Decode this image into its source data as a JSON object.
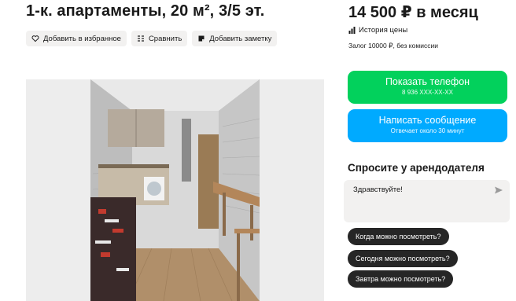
{
  "listing": {
    "title": "1-к. апартаменты, 20 м², 3/5 эт."
  },
  "actions": {
    "favorite": "Добавить в избранное",
    "compare": "Сравнить",
    "note": "Добавить заметку"
  },
  "pricing": {
    "price": "14 500 ₽ в месяц",
    "history": "История цены",
    "deposit": "Залог 10000 ₽, без комиссии"
  },
  "contact": {
    "phone_label": "Показать телефон",
    "phone_number": "8 936 XXX-XX-XX",
    "message_label": "Написать сообщение",
    "message_sub": "Отвечает около 30 минут"
  },
  "ask": {
    "title": "Спросите у арендодателя",
    "input_value": "Здравствуйте!",
    "suggestions": [
      "Когда можно посмотреть?",
      "Сегодня можно посмотреть?",
      "Завтра можно посмотреть?"
    ]
  },
  "icons": {
    "favorite": "heart-icon",
    "compare": "compare-icon",
    "note": "note-icon",
    "history": "chart-icon",
    "send": "send-icon"
  },
  "colors": {
    "phone_button": "#02d15c",
    "message_button": "#00aaff",
    "chip": "#262626",
    "secondary_button": "#f2f1f0"
  }
}
